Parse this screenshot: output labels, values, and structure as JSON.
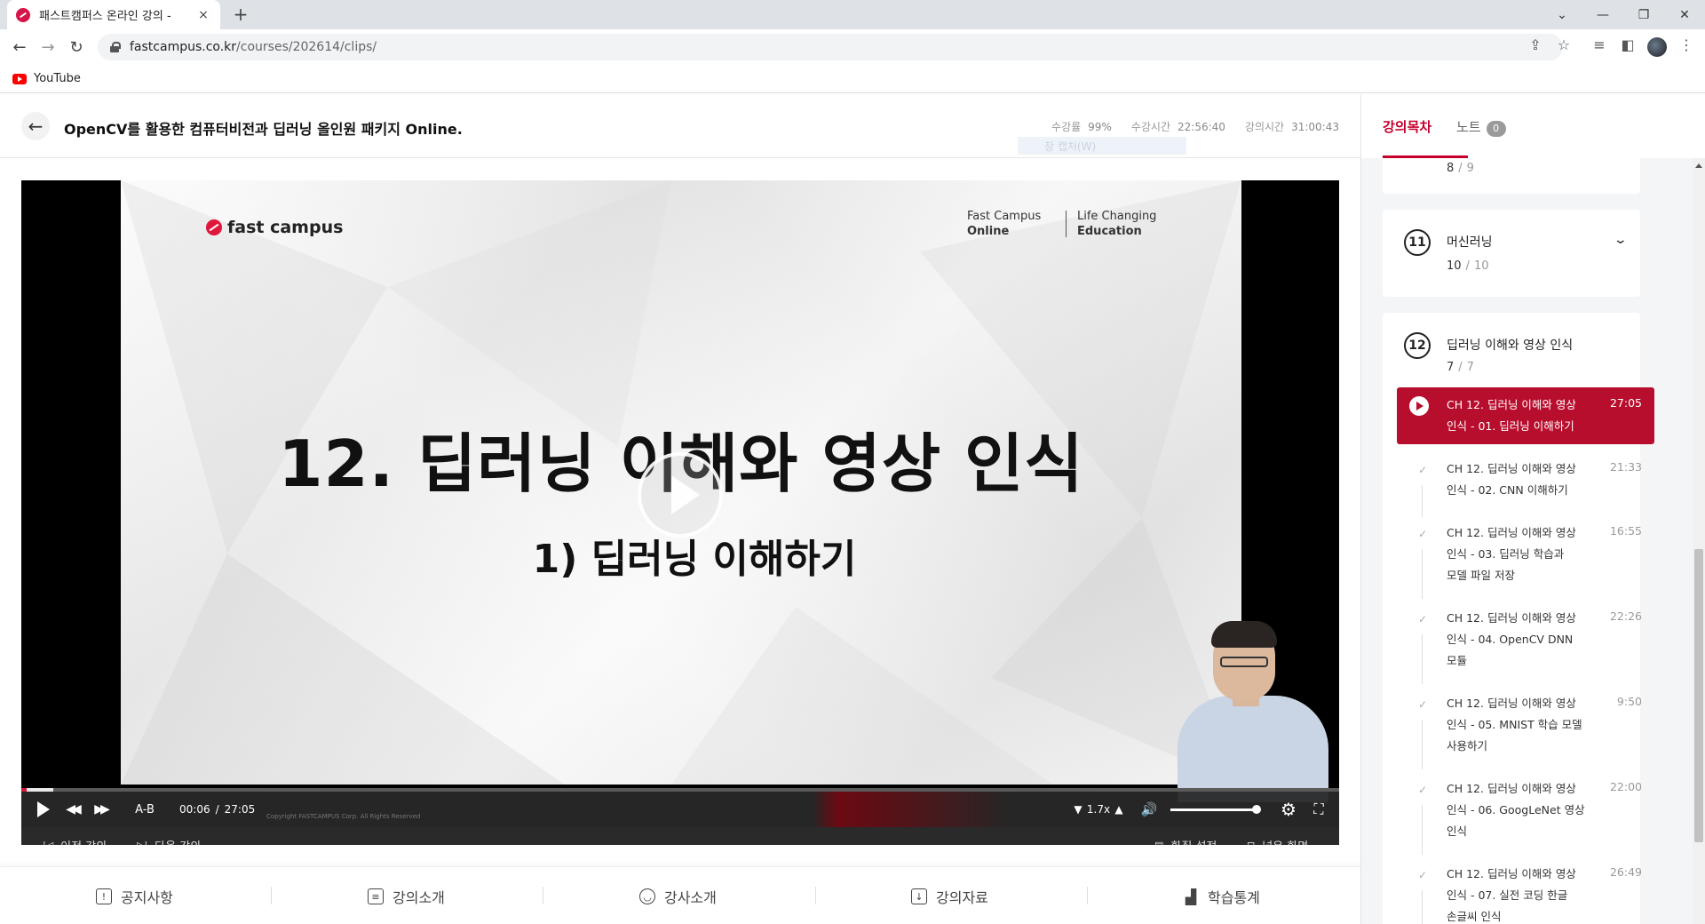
{
  "browser": {
    "tab_title": "패스트캠퍼스 온라인 강의 -",
    "tab_close": "×",
    "new_tab": "+",
    "url_host": "fastcampus.co.kr",
    "url_path": "/courses/202614/clips/",
    "bookmark_youtube": "YouTube"
  },
  "header": {
    "course_title": "OpenCV를 활용한 컴퓨터비전과 딥러닝 올인원 패키지 Online.",
    "stats": [
      {
        "label": "수강률",
        "value": "99%"
      },
      {
        "label": "수강시간",
        "value": "22:56:40"
      },
      {
        "label": "강의시간",
        "value": "31:00:43"
      }
    ],
    "overlay_text": "창 캡처(W)"
  },
  "video": {
    "logo_text": "fast campus",
    "slogan_left": [
      "Fast Campus",
      "Online"
    ],
    "slogan_right": [
      "Life Changing",
      "Education"
    ],
    "slide_title": "12. 딥러닝 이해와 영상 인식",
    "slide_subtitle": "1) 딥러닝 이해하기",
    "progress": 0.004,
    "controls": {
      "ab_repeat": "A-B",
      "current_time": "00:06",
      "time_separator": "/",
      "duration": "27:05",
      "speed": "1.7x",
      "volume": 1.0,
      "copyright": "Copyright FASTCAMPUS Corp. All Rights Reserved"
    },
    "sub_controls": {
      "prev_lecture": "이전 강의",
      "next_lecture": "다음 강의",
      "quality": "화질 설정",
      "wide_screen": "넓은 화면"
    }
  },
  "bottom_tabs": [
    {
      "label": "공지사항"
    },
    {
      "label": "강의소개"
    },
    {
      "label": "강사소개"
    },
    {
      "label": "강의자료"
    },
    {
      "label": "학습통계"
    }
  ],
  "panel": {
    "tab_curriculum": "강의목차",
    "tab_notes": "노트",
    "notes_count": "0",
    "prev_chapter_count": {
      "done": "8",
      "total": "9"
    },
    "chapter11": {
      "num": "11",
      "title": "머신러닝",
      "done": "10",
      "total": "10"
    },
    "chapter12": {
      "num": "12",
      "title": "딥러닝 이해와 영상 인식",
      "done": "7",
      "total": "7"
    },
    "lessons": [
      {
        "title": "CH 12. 딥러닝 이해와 영상 인식 - 01. 딥러닝 이해하기",
        "line1": "CH 12. 딥러닝 이해와 영상",
        "line2": "인식 - 01. 딥러닝 이해하기",
        "line3": "",
        "time": "27:05"
      },
      {
        "line1": "CH 12. 딥러닝 이해와 영상",
        "line2": "인식 - 02. CNN 이해하기",
        "line3": "",
        "time": "21:33"
      },
      {
        "line1": "CH 12. 딥러닝 이해와 영상",
        "line2": "인식 - 03. 딥러닝 학습과",
        "line3": "모델 파일 저장",
        "time": "16:55"
      },
      {
        "line1": "CH 12. 딥러닝 이해와 영상",
        "line2": "인식 - 04. OpenCV DNN",
        "line3": "모듈",
        "time": "22:26"
      },
      {
        "line1": "CH 12. 딥러닝 이해와 영상",
        "line2": "인식 - 05. MNIST 학습 모델",
        "line3": "사용하기",
        "time": "9:50"
      },
      {
        "line1": "CH 12. 딥러닝 이해와 영상",
        "line2": "인식 - 06. GoogLeNet 영상",
        "line3": "인식",
        "time": "22:00"
      },
      {
        "line1": "CH 12. 딥러닝 이해와 영상",
        "line2": "인식 - 07. 실전 코딩 한글",
        "line3": "손글씨 인식",
        "time": "26:49"
      }
    ]
  },
  "colors": {
    "accent": "#c5002d",
    "active_lesson": "#b80e2d",
    "brand_red": "#e0173c"
  }
}
